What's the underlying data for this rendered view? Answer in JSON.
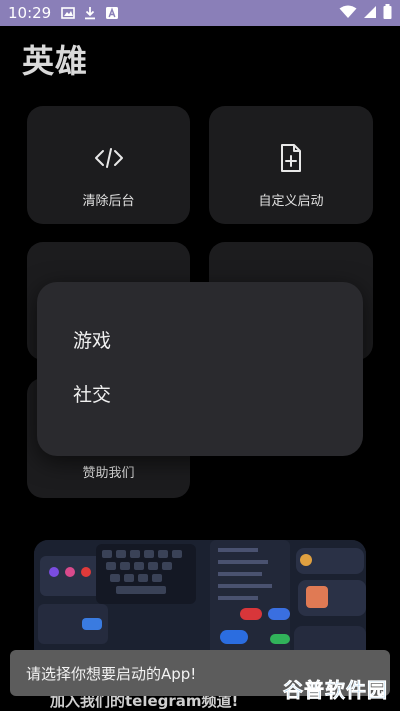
{
  "status_bar": {
    "time": "10:29",
    "left_icons": [
      "image-icon",
      "download-icon",
      "a-notification-icon"
    ],
    "right_icons": [
      "wifi-icon",
      "signal-icon",
      "battery-icon"
    ],
    "background": "#8a7fb8"
  },
  "page": {
    "title": "英雄"
  },
  "cards": [
    {
      "label": "清除后台",
      "icon": "code-icon"
    },
    {
      "label": "自定义启动",
      "icon": "file-plus-icon"
    },
    {
      "label": "",
      "icon": "card-3-icon"
    },
    {
      "label": "",
      "icon": "card-4-icon"
    },
    {
      "label": "赞助我们",
      "icon": ""
    }
  ],
  "popup_menu": {
    "items": [
      "游戏",
      "社交"
    ]
  },
  "banner": {
    "caption": "加入我们的telegram频道!"
  },
  "toast": {
    "message": "请选择你想要启动的App!"
  },
  "watermark": {
    "text": "谷普软件园"
  }
}
